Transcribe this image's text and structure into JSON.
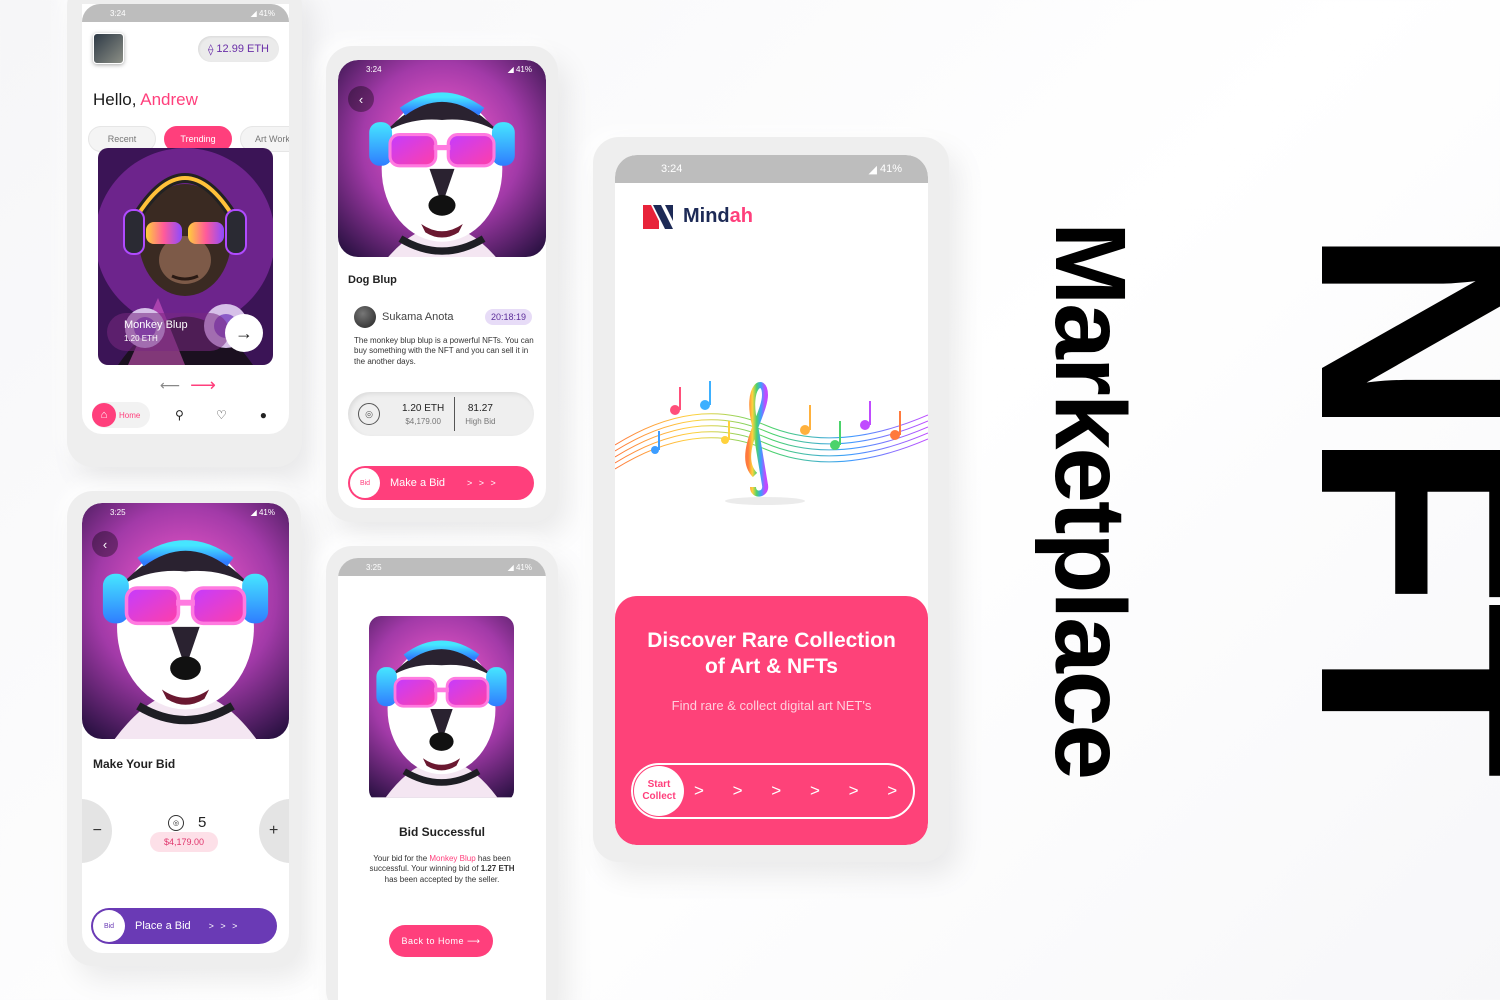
{
  "headline": {
    "primary": "NFT",
    "secondary": "Marketplace"
  },
  "colors": {
    "accent_pink": "#ff3f7c",
    "accent_purple": "#6a3ab5",
    "brand_navy": "#1d2a56"
  },
  "home_screen": {
    "status_time": "3:24",
    "status_battery": "41%",
    "balance": "12.99 ETH",
    "greeting": "Hello,",
    "user_name": "Andrew",
    "tabs": [
      {
        "label": "Recent",
        "active": false
      },
      {
        "label": "Trending",
        "active": true
      },
      {
        "label": "Art Work",
        "active": false
      }
    ],
    "featured": {
      "name": "Monkey Blup",
      "price": "1.20 ETH"
    },
    "nav": {
      "home_label": "Home",
      "icons": [
        "home-icon",
        "search-icon",
        "heart-icon",
        "user-icon"
      ]
    }
  },
  "detail_screen": {
    "status_time": "3:24",
    "status_battery": "41%",
    "title": "Dog Blup",
    "creator": "Sukama Anota",
    "timer": "20:18:19",
    "description": "The monkey blup blup is a powerful NFTs. You can buy something with the NFT and you can sell it in the another days.",
    "price_eth": "1.20 ETH",
    "price_usd": "$4,179.00",
    "high_bid_value": "81.27",
    "high_bid_label": "High Bid",
    "button_circle": "Bid",
    "button_label": "Make a Bid",
    "button_arrows": "> > >"
  },
  "bid_screen": {
    "status_time": "3:25",
    "status_battery": "41%",
    "title": "Make Your Bid",
    "minus": "−",
    "plus": "+",
    "quantity": "5",
    "usd_value": "$4,179.00",
    "button_circle": "Bid",
    "button_label": "Place a Bid",
    "button_arrows": "> > >"
  },
  "success_screen": {
    "status_time": "3:25",
    "status_battery": "41%",
    "title": "Bid Successful",
    "msg_part1": "Your bid for the ",
    "msg_item": "Monkey Blup",
    "msg_part2": " has been successful. Your winning bid of ",
    "msg_amount": "1.27 ETH",
    "msg_part3": " has been accepted by the seller.",
    "button_label": "Back to Home ⟶"
  },
  "splash_screen": {
    "status_time": "3:24",
    "status_battery": "41%",
    "brand_part1": "Mind",
    "brand_part2": "ah",
    "panel_title": "Discover Rare Collection of Art & NFTs",
    "panel_subtitle": "Find rare & collect digital art NET's",
    "start_label_1": "Start",
    "start_label_2": "Collect",
    "start_arrows": "> > > > > >"
  }
}
